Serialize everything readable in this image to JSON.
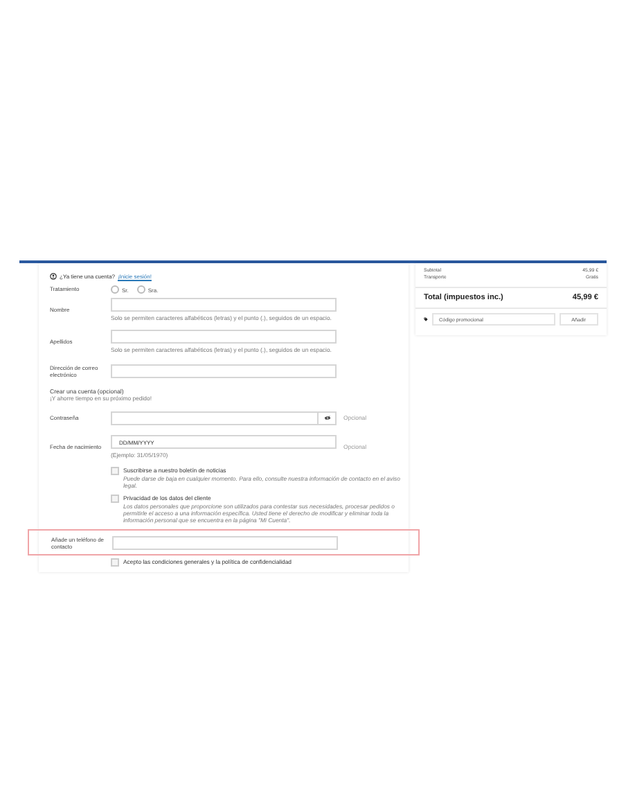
{
  "account_prompt": {
    "text": "¿Ya tiene una cuenta?",
    "link": "¡Inicie sesión!"
  },
  "rows": [
    {
      "kind": "radio",
      "label": "Tratamiento",
      "options": [
        {
          "label": "Sr.",
          "selected": false
        },
        {
          "label": "Sra.",
          "selected": false
        }
      ]
    },
    {
      "kind": "input",
      "label": "Nombre",
      "hint": "Solo se permiten caracteres alfabéticos (letras) y el punto (.), seguidos de un espacio."
    },
    {
      "kind": "input",
      "label": "Apellidos",
      "hint": "Solo se permiten caracteres alfabéticos (letras) y el punto (.), seguidos de un espacio."
    },
    {
      "kind": "input",
      "label": "Dirección de correo electrónico"
    },
    {
      "kind": "section",
      "title": "Crear una cuenta (opcional)",
      "subtitle": "¡Y ahorre tiempo en su próximo pedido!"
    },
    {
      "kind": "password",
      "label": "Contraseña",
      "note": "Opcional"
    },
    {
      "kind": "input",
      "label": "Fecha de nacimiento",
      "placeholder": "DD/MM/YYYY",
      "hint": "(Ejemplo: 31/05/1970)",
      "note": "Opcional"
    },
    {
      "kind": "checkbox",
      "label": "Suscribirse a nuestro boletín de noticias",
      "checked": false,
      "text": "Puede darse de baja en cualquier momento. Para ello, consulte nuestra información de contacto en el aviso legal."
    },
    {
      "kind": "checkbox",
      "label": "Privacidad de los datos del cliente",
      "checked": false,
      "text": "Los datos personales que proporcione son utilizados para contestar sus necesidades, procesar pedidos o permitirle el acceso a una información específica. Usted tiene el derecho de modificar y eliminar toda la información personal que se encuentra en la página \"Mi Cuenta\"."
    },
    {
      "kind": "input",
      "label": "Añade un teléfono de contacto",
      "highlighted": true
    },
    {
      "kind": "checkbox",
      "label": "Acepto las condiciones generales y la política de confidencialidad",
      "checked": false
    }
  ],
  "summary": {
    "lines": [
      {
        "label": "Subtotal",
        "value": "45,99 €"
      },
      {
        "label": "Transporte",
        "value": "Gratis"
      }
    ],
    "total": {
      "label": "Total (impuestos inc.)",
      "value": "45,99 €"
    },
    "promo": {
      "placeholder": "Código promocional",
      "button": "Añadir"
    }
  }
}
